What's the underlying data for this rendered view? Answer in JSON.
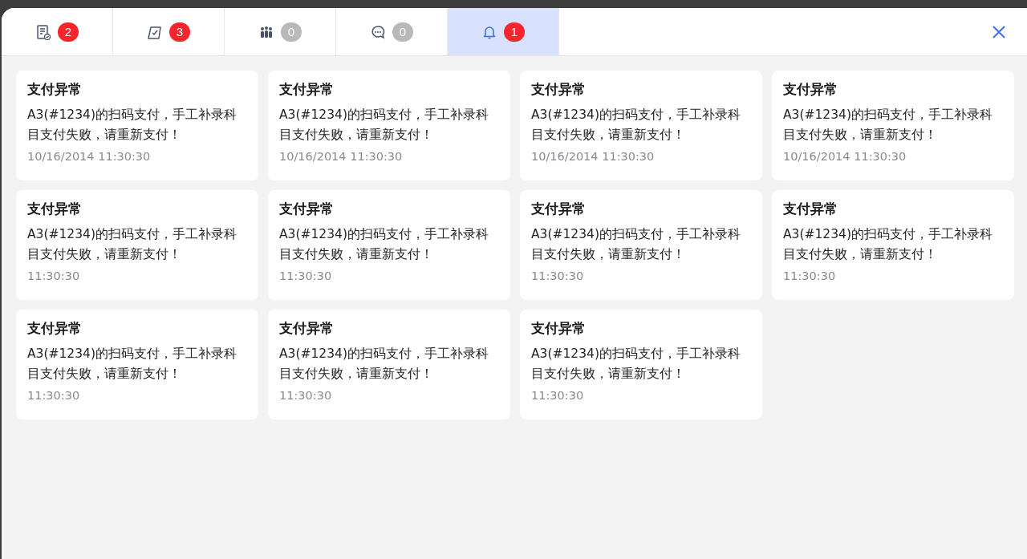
{
  "tabs": [
    {
      "kind": "document",
      "badge": "2",
      "unread": true,
      "selected": false
    },
    {
      "kind": "checklist",
      "badge": "3",
      "unread": true,
      "selected": false
    },
    {
      "kind": "people",
      "badge": "0",
      "unread": false,
      "selected": false
    },
    {
      "kind": "chat",
      "badge": "0",
      "unread": false,
      "selected": false
    },
    {
      "kind": "bell",
      "badge": "1",
      "unread": true,
      "selected": true
    }
  ],
  "notifications": [
    {
      "title": "支付异常",
      "body": "A3(#1234)的扫码支付，手工补录科目支付失败，请重新支付！",
      "time": "10/16/2014 11:30:30"
    },
    {
      "title": "支付异常",
      "body": "A3(#1234)的扫码支付，手工补录科目支付失败，请重新支付！",
      "time": "10/16/2014 11:30:30"
    },
    {
      "title": "支付异常",
      "body": "A3(#1234)的扫码支付，手工补录科目支付失败，请重新支付！",
      "time": "10/16/2014 11:30:30"
    },
    {
      "title": "支付异常",
      "body": "A3(#1234)的扫码支付，手工补录科目支付失败，请重新支付！",
      "time": "10/16/2014 11:30:30"
    },
    {
      "title": "支付异常",
      "body": "A3(#1234)的扫码支付，手工补录科目支付失败，请重新支付！",
      "time": "11:30:30"
    },
    {
      "title": "支付异常",
      "body": "A3(#1234)的扫码支付，手工补录科目支付失败，请重新支付！",
      "time": "11:30:30"
    },
    {
      "title": "支付异常",
      "body": "A3(#1234)的扫码支付，手工补录科目支付失败，请重新支付！",
      "time": "11:30:30"
    },
    {
      "title": "支付异常",
      "body": "A3(#1234)的扫码支付，手工补录科目支付失败，请重新支付！",
      "time": "11:30:30"
    },
    {
      "title": "支付异常",
      "body": "A3(#1234)的扫码支付，手工补录科目支付失败，请重新支付！",
      "time": "11:30:30"
    },
    {
      "title": "支付异常",
      "body": "A3(#1234)的扫码支付，手工补录科目支付失败，请重新支付！",
      "time": "11:30:30"
    },
    {
      "title": "支付异常",
      "body": "A3(#1234)的扫码支付，手工补录科目支付失败，请重新支付！",
      "time": "11:30:30"
    }
  ]
}
